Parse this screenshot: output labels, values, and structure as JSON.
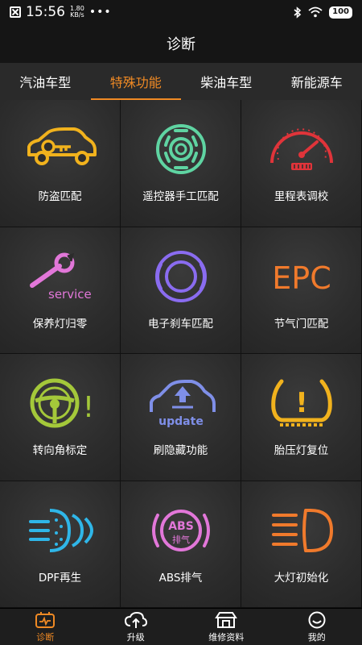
{
  "status_bar": {
    "time": "15:56",
    "speed_value": "1.80",
    "speed_unit": "KB/s",
    "dots": "•••",
    "battery": "100"
  },
  "title": "诊断",
  "tabs": [
    {
      "label": "汽油车型"
    },
    {
      "label": "特殊功能"
    },
    {
      "label": "柴油车型"
    },
    {
      "label": "新能源车"
    }
  ],
  "functions": [
    {
      "label": "防盗匹配",
      "icon": "immobilizer-key-icon"
    },
    {
      "label": "遥控器手工匹配",
      "icon": "remote-key-icon"
    },
    {
      "label": "里程表调校",
      "icon": "odometer-icon"
    },
    {
      "label": "保养灯归零",
      "icon": "service-wrench-icon",
      "icon_text": "service"
    },
    {
      "label": "电子刹车匹配",
      "icon": "electronic-brake-icon"
    },
    {
      "label": "节气门匹配",
      "icon": "epc-throttle-icon",
      "icon_text": "EPC"
    },
    {
      "label": "转向角标定",
      "icon": "steering-angle-icon",
      "icon_text": "!"
    },
    {
      "label": "刷隐藏功能",
      "icon": "hidden-function-update-icon",
      "icon_text": "update"
    },
    {
      "label": "胎压灯复位",
      "icon": "tire-pressure-icon",
      "icon_text": "!"
    },
    {
      "label": "DPF再生",
      "icon": "dpf-regeneration-icon"
    },
    {
      "label": "ABS排气",
      "icon": "abs-bleed-icon",
      "icon_text": "ABS",
      "icon_subtext": "排气"
    },
    {
      "label": "大灯初始化",
      "icon": "headlight-icon"
    }
  ],
  "bottom_nav": [
    {
      "label": "诊断",
      "icon": "diagnose-icon"
    },
    {
      "label": "升级",
      "icon": "cloud-upgrade-icon"
    },
    {
      "label": "维修资料",
      "icon": "repair-data-icon"
    },
    {
      "label": "我的",
      "icon": "profile-smile-icon"
    }
  ],
  "colors": {
    "accent": "#f08a24",
    "yellow": "#f1b21d",
    "green": "#5fd4a2",
    "red": "#e0343a",
    "pink": "#e277d9",
    "purple": "#8a6cf0",
    "orange": "#f07a2c",
    "blue": "#2fb6e8"
  }
}
